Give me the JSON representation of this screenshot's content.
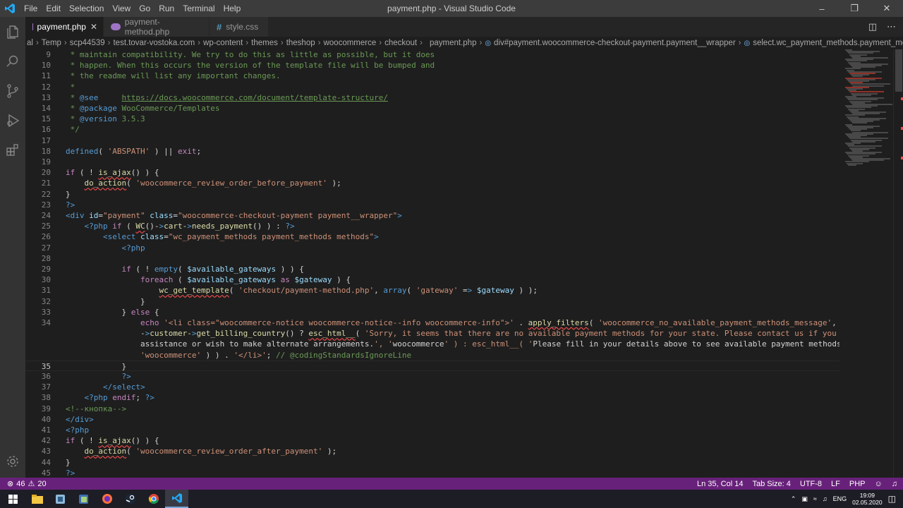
{
  "titlebar": {
    "title": "payment.php - Visual Studio Code",
    "menu": [
      "File",
      "Edit",
      "Selection",
      "View",
      "Go",
      "Run",
      "Terminal",
      "Help"
    ]
  },
  "tabs": [
    {
      "label": "payment.php",
      "icon": "php-icon",
      "active": true
    },
    {
      "label": "payment-method.php",
      "icon": "php-icon",
      "active": false
    },
    {
      "label": "style.css",
      "icon": "css-icon",
      "active": false
    }
  ],
  "breadcrumb": [
    "al",
    "Temp",
    "scp44539",
    "test.tovar-vostoka.com",
    "wp-content",
    "themes",
    "theshop",
    "woocommerce",
    "checkout",
    "payment.php",
    "div#payment.woocommerce-checkout-payment.payment__wrapper",
    "select.wc_payment_methods.payment_methods.methods"
  ],
  "editor": {
    "cursor_line": 35,
    "line_numbers": [
      "9",
      "10",
      "11",
      "12",
      "13",
      "14",
      "15",
      "16",
      "17",
      "18",
      "19",
      "20",
      "21",
      "22",
      "23",
      "24",
      "25",
      "26",
      "27",
      "28",
      "29",
      "30",
      "31",
      "32",
      "33",
      "34",
      "",
      "",
      "",
      "35",
      "36",
      "37",
      "38",
      "39",
      "40",
      "41",
      "42",
      "43",
      "44",
      "45"
    ],
    "lines": [
      " * maintain compatibility. We try to do this as little as possible, but it does",
      " * happen. When this occurs the version of the template file will be bumped and",
      " * the readme will list any important changes.",
      " *",
      " * @see     https://docs.woocommerce.com/document/template-structure/",
      " * @package WooCommerce/Templates",
      " * @version 3.5.3",
      " */",
      "",
      "defined( 'ABSPATH' ) || exit;",
      "",
      "if ( ! is_ajax() ) {",
      "    do_action( 'woocommerce_review_order_before_payment' );",
      "}",
      "?>",
      "<div id=\"payment\" class=\"woocommerce-checkout-payment payment__wrapper\">",
      "    <?php if ( WC()->cart->needs_payment() ) : ?>",
      "        <select class=\"wc_payment_methods payment_methods methods\">",
      "            <?php",
      "",
      "            if ( ! empty( $available_gateways ) ) {",
      "                foreach ( $available_gateways as $gateway ) {",
      "                    wc_get_template( 'checkout/payment-method.php', array( 'gateway' => $gateway ) );",
      "                }",
      "            } else {",
      "                echo '<li class=\"woocommerce-notice woocommerce-notice--info woocommerce-info\">' . apply_filters( 'woocommerce_no_available_payment_methods_message', WC()",
      "                ->customer->get_billing_country() ? esc_html__( 'Sorry, it seems that there are no available payment methods for your state. Please contact us if you require",
      "                assistance or wish to make alternate arrangements.', 'woocommerce' ) : esc_html__( 'Please fill in your details above to see available payment methods.',",
      "                'woocommerce' ) ) . '</li>'; // @codingStandardsIgnoreLine",
      "            }",
      "            ?>",
      "        </select>",
      "    <?php endif; ?>",
      "<!--кнопка-->",
      "</div>",
      "<?php",
      "if ( ! is_ajax() ) {",
      "    do_action( 'woocommerce_review_order_after_payment' );",
      "}",
      "?>"
    ]
  },
  "statusbar": {
    "errors": "46",
    "warnings": "20",
    "position": "Ln 35, Col 14",
    "tab_size": "Tab Size: 4",
    "encoding": "UTF-8",
    "eol": "LF",
    "language": "PHP"
  },
  "taskbar": {
    "lang": "ENG",
    "time": "19:09",
    "date": "02.05.2020"
  },
  "colors": {
    "statusbar": "#68217a",
    "titlebar": "#3c3c3c",
    "editor_bg": "#1e1e1e",
    "accent": "#007acc"
  }
}
